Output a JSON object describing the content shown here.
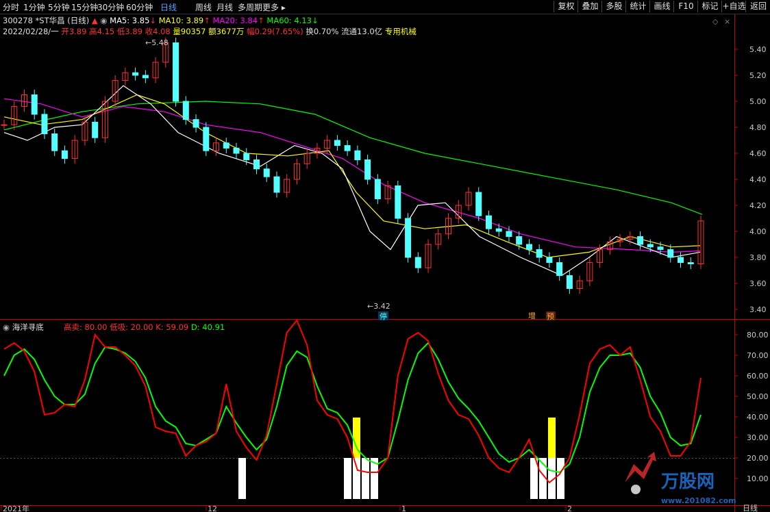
{
  "toolbar": {
    "tabs": [
      "分时",
      "1分钟",
      "5分钟",
      "15分钟",
      "30分钟",
      "60分钟",
      "日线",
      "周线",
      "月线",
      "多周期",
      "更多"
    ],
    "active_tab": "日线",
    "right_buttons": [
      "复权",
      "叠加",
      "多股",
      "统计",
      "画线",
      "F10",
      "标记",
      "+自选",
      "返回"
    ]
  },
  "header": {
    "code_name": "300278 *ST华昌 (日线)",
    "ma5": "MA5: 3.85",
    "ma10": "MA10: 3.89",
    "ma20": "MA20: 3.84",
    "ma60": "MA60: 4.13",
    "date": "2022/02/28/一",
    "open": "开3.89",
    "high": "高4.15",
    "low": "低3.89",
    "close": "收4.08",
    "vol": "量90357",
    "amount": "额3677万",
    "change": "幅0.29(7.65%)",
    "turnover": "换0.70%",
    "float": "流通13.0亿",
    "sector": "专用机械"
  },
  "colors": {
    "up": "#ff3232",
    "down": "#54ffff",
    "ma5": "#ffffff",
    "ma10": "#ffff00",
    "ma20": "#ff00ff",
    "ma60": "#00ff00",
    "k": "#ff0000",
    "d": "#00ff00",
    "axis": "#c80000",
    "text": "#ccc"
  },
  "price_chart": {
    "y_ticks": [
      "5.40",
      "5.20",
      "5.00",
      "4.80",
      "4.60",
      "4.40",
      "4.20",
      "4.00",
      "3.80",
      "3.60",
      "3.40"
    ],
    "high_label": "5.48",
    "low_label": "3.42",
    "markers": [
      "停",
      "增",
      "预"
    ]
  },
  "indicator": {
    "name": "海洋寻底",
    "params": "高卖: 80.00  低吸: 20.00",
    "k": "K: 59.09",
    "d": "D: 40.91",
    "y_ticks": [
      "80.00",
      "70.00",
      "60.00",
      "50.00",
      "40.00",
      "30.00",
      "20.00",
      "10.00"
    ]
  },
  "x_axis": {
    "labels": [
      "2021年",
      "12",
      "1",
      "2"
    ],
    "right_label": "日线"
  },
  "watermark": {
    "logo": "万股网",
    "url": "www.201082.com"
  },
  "chart_data": {
    "type": "candlestick",
    "kdj_k": [
      73,
      76,
      72,
      62,
      41,
      42,
      46,
      45,
      58,
      80,
      74,
      74,
      70,
      65,
      55,
      35,
      33,
      32,
      21,
      26,
      28,
      32,
      56,
      33,
      25,
      19,
      31,
      56,
      81,
      87,
      75,
      48,
      41,
      39,
      30,
      14,
      13,
      13,
      20,
      60,
      78,
      81,
      77,
      61,
      48,
      41,
      39,
      31,
      20,
      15,
      13,
      20,
      29,
      14,
      8,
      12,
      20,
      41,
      66,
      73,
      75,
      70,
      74,
      58,
      40,
      33,
      21,
      21,
      28,
      59
    ],
    "kdj_d": [
      60,
      70,
      73,
      68,
      58,
      50,
      46,
      46,
      51,
      66,
      74,
      73,
      71,
      67,
      59,
      45,
      38,
      35,
      27,
      26,
      29,
      32,
      45,
      37,
      30,
      24,
      29,
      45,
      65,
      72,
      69,
      55,
      44,
      42,
      36,
      24,
      19,
      17,
      20,
      38,
      58,
      71,
      76,
      68,
      57,
      49,
      44,
      38,
      30,
      22,
      18,
      20,
      24,
      19,
      14,
      13,
      17,
      30,
      52,
      64,
      70,
      70,
      71,
      64,
      50,
      42,
      30,
      26,
      27,
      41
    ]
  }
}
